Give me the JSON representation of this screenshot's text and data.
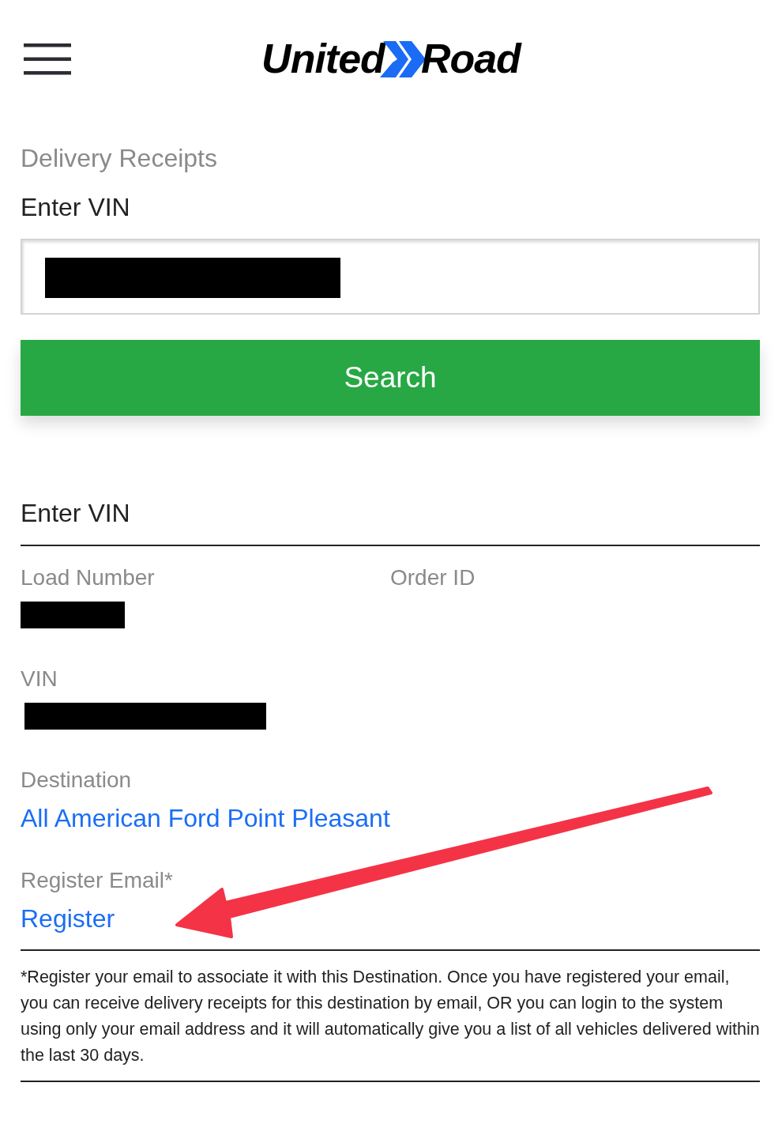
{
  "logo": {
    "text_left": "United",
    "text_right": "Road"
  },
  "page_title": "Delivery Receipts",
  "search_form": {
    "label": "Enter VIN",
    "input": {
      "redacted": true
    },
    "button": "Search"
  },
  "result": {
    "heading": "Enter VIN",
    "rows": [
      {
        "fields": [
          {
            "label": "Load Number",
            "redacted": true
          },
          {
            "label": "Order ID"
          }
        ]
      },
      {
        "fields": [
          {
            "label": "VIN",
            "redacted": true
          }
        ]
      },
      {
        "fields": [
          {
            "label": "Destination",
            "link": "All American Ford Point Pleasant"
          }
        ]
      },
      {
        "fields": [
          {
            "label": "Register Email*",
            "link": "Register"
          }
        ]
      }
    ],
    "footnote": "*Register your email to associate it with this Destination. Once you have registered your email, you can receive delivery receipts for this destination by email, OR you can login to the system using only your email address and it will automatically give you a list of all vehicles delivered within the last 30 days."
  },
  "annotations": [
    {
      "kind": "arrow"
    }
  ]
}
